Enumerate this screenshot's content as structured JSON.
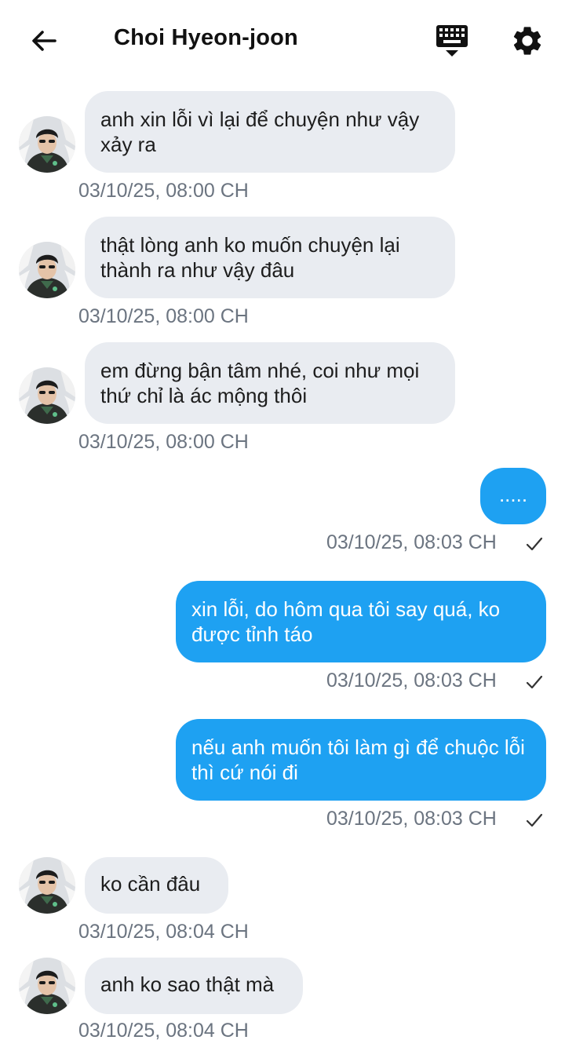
{
  "header": {
    "title": "Choi Hyeon-joon",
    "back_icon": "arrow-left-icon",
    "keyboard_icon": "keyboard-icon",
    "settings_icon": "gear-icon"
  },
  "colors": {
    "incoming_bubble": "#e9ecf1",
    "outgoing_bubble": "#1ea1f2",
    "timestamp": "#6b7480"
  },
  "messages": [
    {
      "direction": "incoming",
      "text": "anh xin lỗi vì lại để chuyện như vậy xảy ra",
      "time": "03/10/25, 08:00 CH"
    },
    {
      "direction": "incoming",
      "text": "thật lòng anh ko muốn chuyện lại thành ra như vậy đâu",
      "time": "03/10/25, 08:00 CH"
    },
    {
      "direction": "incoming",
      "text": "em đừng bận tâm nhé, coi như mọi thứ chỉ là ác mộng thôi",
      "time": "03/10/25, 08:00 CH"
    },
    {
      "direction": "outgoing",
      "text": ".....",
      "time": "03/10/25, 08:03 CH",
      "status_icon": "check-icon"
    },
    {
      "direction": "outgoing",
      "text": "xin lỗi, do hôm qua tôi say quá, ko được tỉnh táo",
      "time": "03/10/25, 08:03 CH",
      "status_icon": "check-icon"
    },
    {
      "direction": "outgoing",
      "text": "nếu anh muốn tôi làm gì để chuộc lỗi thì cứ nói đi",
      "time": "03/10/25, 08:03 CH",
      "status_icon": "check-icon"
    },
    {
      "direction": "incoming",
      "text": "ko cần đâu",
      "time": "03/10/25, 08:04 CH"
    },
    {
      "direction": "incoming",
      "text": "anh ko sao thật mà",
      "time": "03/10/25, 08:04 CH"
    }
  ]
}
